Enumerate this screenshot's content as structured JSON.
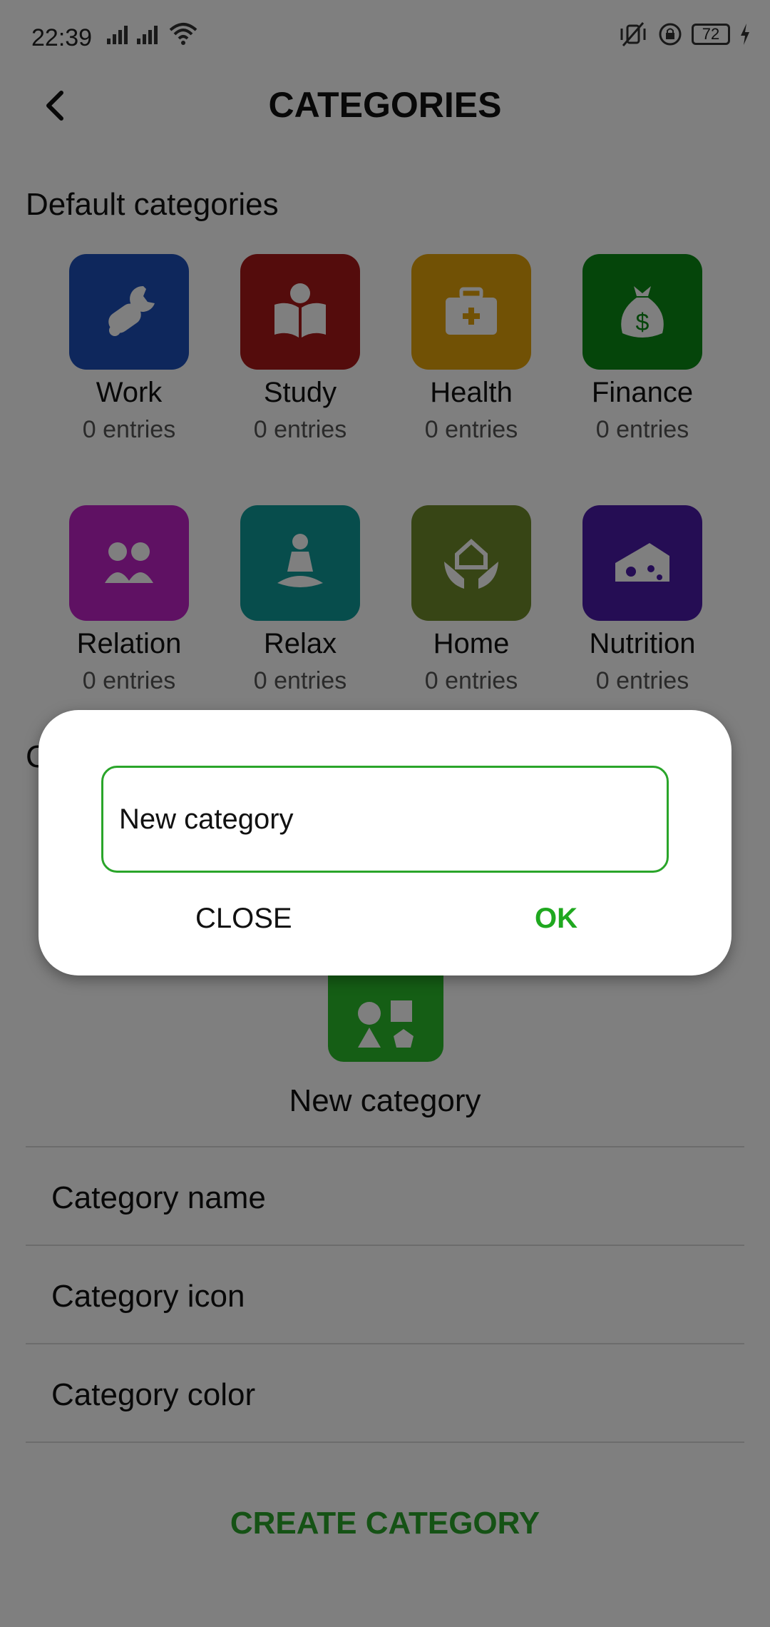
{
  "status_bar": {
    "time": "22:39",
    "battery": "72"
  },
  "app_bar": {
    "title": "CATEGORIES"
  },
  "default_section": {
    "title": "Default categories",
    "items": [
      {
        "name": "Work",
        "count": "0 entries",
        "color": "#1d4fb8",
        "icon": "tools-icon"
      },
      {
        "name": "Study",
        "count": "0 entries",
        "color": "#a81818",
        "icon": "reading-icon"
      },
      {
        "name": "Health",
        "count": "0 entries",
        "color": "#e3a20b",
        "icon": "medical-kit-icon"
      },
      {
        "name": "Finance",
        "count": "0 entries",
        "color": "#0a8a14",
        "icon": "money-bag-icon"
      },
      {
        "name": "Relation",
        "count": "0 entries",
        "color": "#bf22c6",
        "icon": "people-icon"
      },
      {
        "name": "Relax",
        "count": "0 entries",
        "color": "#0e9a98",
        "icon": "meditation-icon"
      },
      {
        "name": "Home",
        "count": "0 entries",
        "color": "#6f8a2a",
        "icon": "home-hands-icon"
      },
      {
        "name": "Nutrition",
        "count": "0 entries",
        "color": "#4a1aa8",
        "icon": "cheese-icon"
      }
    ]
  },
  "custom_section": {
    "title_partial": "C"
  },
  "sheet": {
    "preview_name": "New category",
    "preview_color": "#2bbd2b",
    "rows": [
      "Category name",
      "Category icon",
      "Category color"
    ],
    "create_label": "CREATE CATEGORY"
  },
  "dialog": {
    "input_value": "New category",
    "close_label": "CLOSE",
    "ok_label": "OK"
  },
  "colors": {
    "accent": "#2aa52a"
  }
}
